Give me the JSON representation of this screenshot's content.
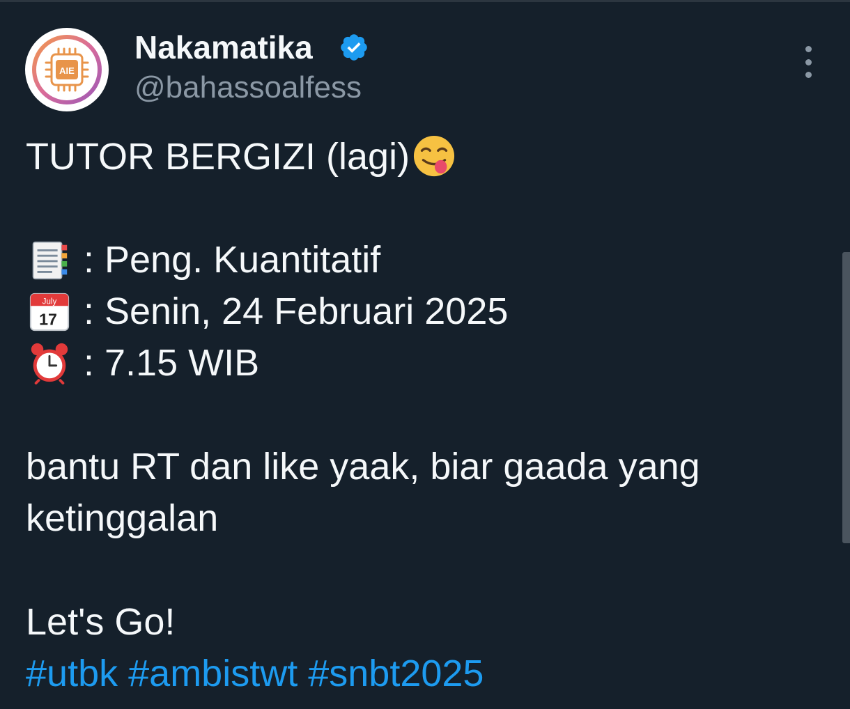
{
  "tweet": {
    "author": {
      "display_name": "Nakamatika",
      "handle": "@bahassoalfess",
      "verified": true,
      "avatar_text": "AIE"
    },
    "lines": {
      "title": "TUTOR BERGIZI (lagi)",
      "subject": ": Peng. Kuantitatif",
      "date": ": Senin, 24 Februari 2025",
      "time": ": 7.15 WIB",
      "body_1": "bantu RT dan like yaak, biar gaada yang",
      "body_2": "ketinggalan",
      "closing": "Let's Go!"
    },
    "hashtags": [
      "#utbk",
      "#ambistwt",
      "#snbt2025"
    ],
    "icons": {
      "title_emoji": "yum-face-icon",
      "subject_emoji": "bookmark-tabs-icon",
      "date_emoji": "calendar-icon",
      "date_emoji_month": "July",
      "date_emoji_day": "17",
      "time_emoji": "alarm-clock-icon"
    }
  },
  "colors": {
    "background": "#15202b",
    "text": "#f5f8fa",
    "muted": "#8b98a5",
    "link": "#1d9bf0",
    "verified": "#1d9bf0"
  }
}
